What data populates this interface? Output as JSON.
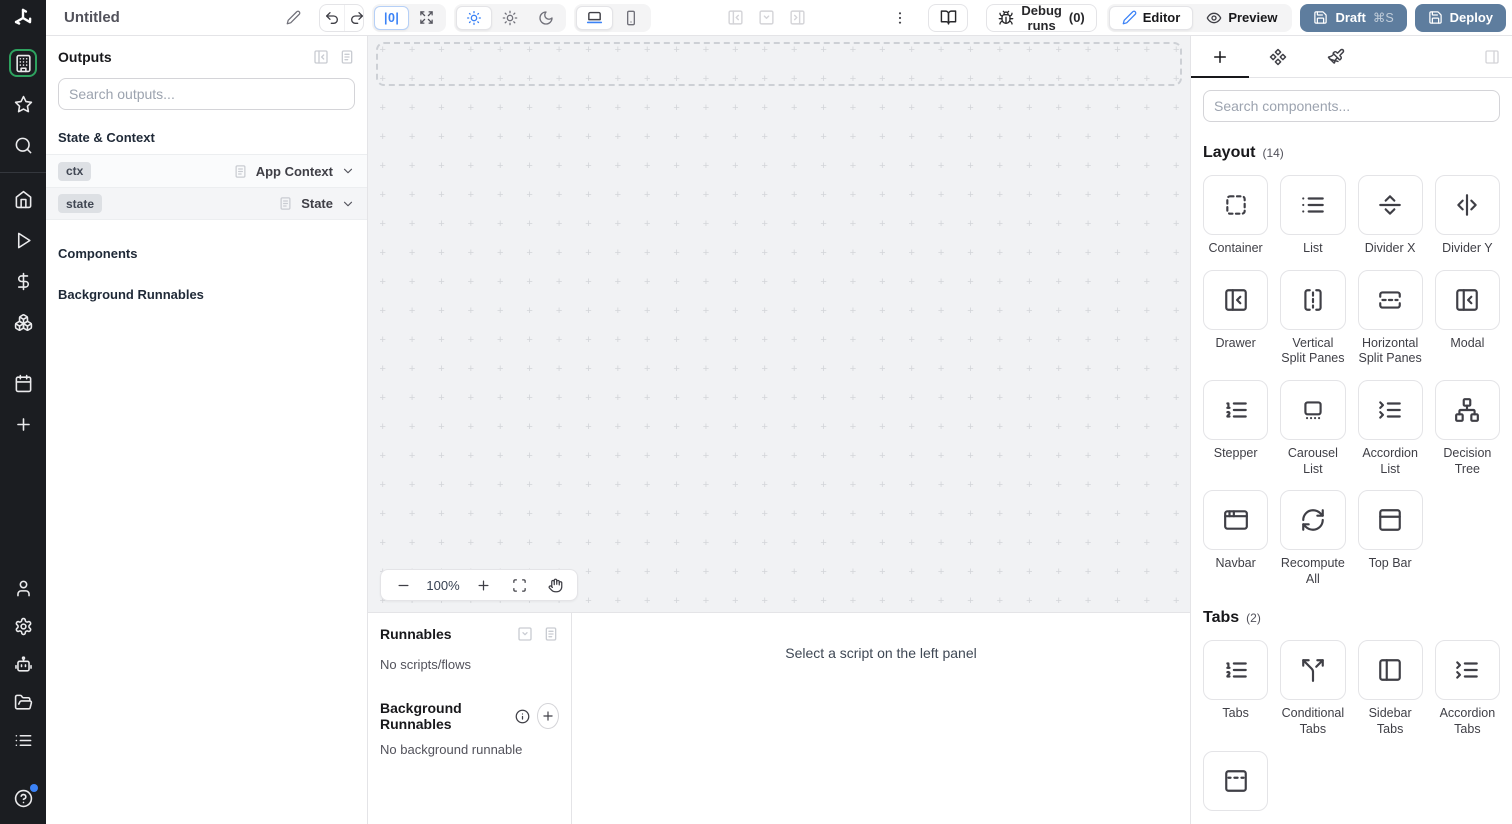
{
  "header": {
    "title": "Untitled",
    "zero_width_label": "|0|",
    "debug_runs_label": "Debug runs",
    "debug_runs_count": "(0)",
    "editor_label": "Editor",
    "preview_label": "Preview",
    "draft_label": "Draft",
    "draft_shortcut": "⌘S",
    "deploy_label": "Deploy"
  },
  "sidebar": {
    "top": [
      {
        "name": "apps",
        "icon": "building",
        "active": true
      },
      {
        "name": "favorites",
        "icon": "star"
      },
      {
        "name": "search",
        "icon": "search"
      }
    ],
    "middle": [
      {
        "name": "home",
        "icon": "home"
      },
      {
        "name": "runs",
        "icon": "play"
      },
      {
        "name": "variables",
        "icon": "dollar"
      },
      {
        "name": "resources",
        "icon": "boxes"
      },
      {
        "name": "schedules",
        "icon": "calendar",
        "gap_before": true
      },
      {
        "name": "create",
        "icon": "plus"
      }
    ],
    "bottom": [
      {
        "name": "account",
        "icon": "user"
      },
      {
        "name": "settings",
        "icon": "settings"
      },
      {
        "name": "workers",
        "icon": "bot"
      },
      {
        "name": "folders",
        "icon": "folder-open"
      },
      {
        "name": "audit-logs",
        "icon": "list-menu"
      },
      {
        "name": "help",
        "icon": "help-circle",
        "gap_before": true,
        "notification_dot": true
      }
    ]
  },
  "outputs_panel": {
    "title": "Outputs",
    "search_placeholder": "Search outputs...",
    "state_context_heading": "State & Context",
    "rows": [
      {
        "badge": "ctx",
        "type": "App Context"
      },
      {
        "badge": "state",
        "type": "State"
      }
    ],
    "components_heading": "Components",
    "background_runnables_heading": "Background Runnables"
  },
  "canvas": {
    "zoom_level": "100%"
  },
  "runnables_panel": {
    "title": "Runnables",
    "empty_text": "No scripts/flows",
    "background_title": "Background Runnables",
    "background_empty_text": "No background runnable",
    "select_hint": "Select a script on the left panel"
  },
  "components_panel": {
    "search_placeholder": "Search components...",
    "sections": [
      {
        "title": "Layout",
        "count": "(14)",
        "items": [
          {
            "label": "Container",
            "icon": "square-dashed"
          },
          {
            "label": "List",
            "icon": "list"
          },
          {
            "label": "Divider X",
            "icon": "separator-horizontal"
          },
          {
            "label": "Divider Y",
            "icon": "separator-vertical"
          },
          {
            "label": "Drawer",
            "icon": "panel-left-close"
          },
          {
            "label": "Vertical Split Panes",
            "icon": "split-panes-vertical"
          },
          {
            "label": "Horizontal Split Panes",
            "icon": "split-panes-horizontal"
          },
          {
            "label": "Modal",
            "icon": "panel-left-close"
          },
          {
            "label": "Stepper",
            "icon": "list-ordered"
          },
          {
            "label": "Carousel List",
            "icon": "carousel"
          },
          {
            "label": "Accordion List",
            "icon": "list-collapse"
          },
          {
            "label": "Decision Tree",
            "icon": "network"
          },
          {
            "label": "Navbar",
            "icon": "app-window"
          },
          {
            "label": "Recompute All",
            "icon": "refresh-cw"
          },
          {
            "label": "Top Bar",
            "icon": "panel-top"
          }
        ]
      },
      {
        "title": "Tabs",
        "count": "(2)",
        "items": [
          {
            "label": "Tabs",
            "icon": "list-ordered"
          },
          {
            "label": "Conditional Tabs",
            "icon": "split"
          },
          {
            "label": "Sidebar Tabs",
            "icon": "panel-left"
          },
          {
            "label": "Accordion Tabs",
            "icon": "list-collapse"
          },
          {
            "label": "",
            "icon": "panel-top-dashed"
          }
        ]
      }
    ]
  },
  "colors": {
    "accent_blue": "#3b82f6",
    "deploy_button": "#5e7d9e",
    "sidebar_active_green": "#2ea25f",
    "sidebar_background": "#1b1d21",
    "canvas_background": "#f1f2f4"
  }
}
